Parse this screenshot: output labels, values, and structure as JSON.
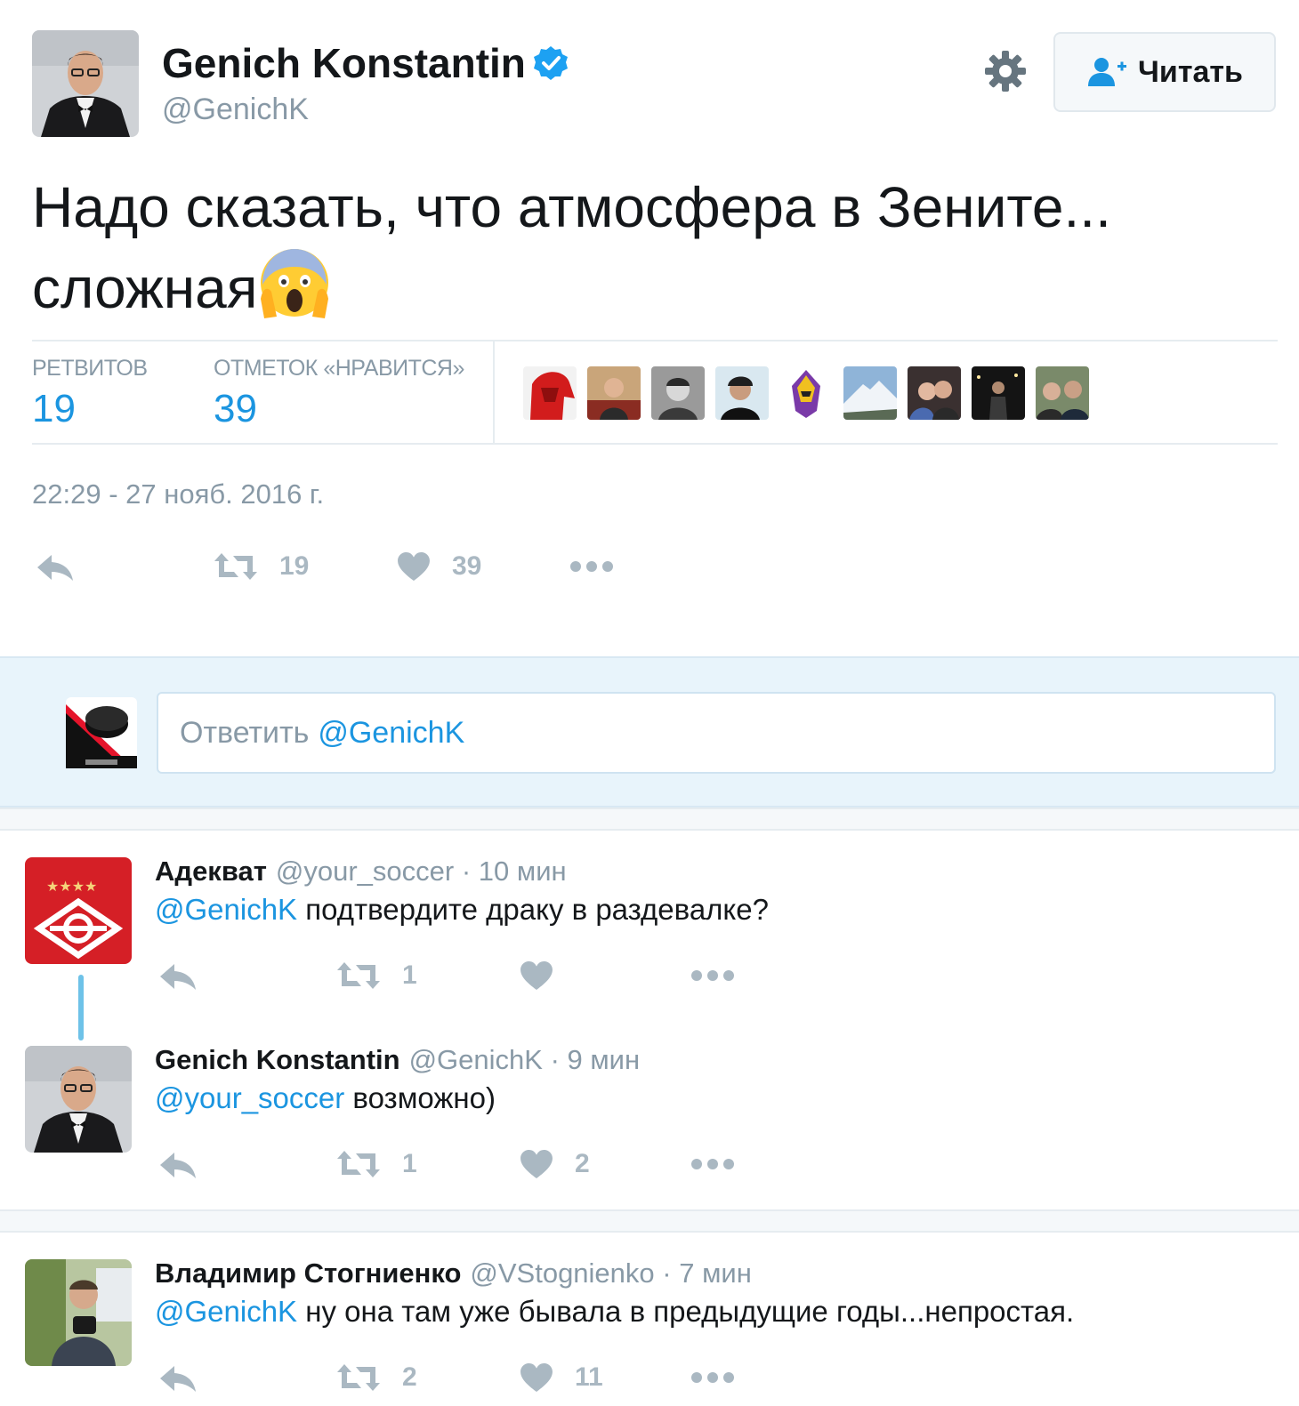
{
  "colors": {
    "accent": "#1b95e0",
    "muted": "#8899a6",
    "icon": "#aab8c2",
    "verified": "#1da1f2"
  },
  "tweet": {
    "author_name": "Genich Konstantin",
    "author_handle": "@GenichK",
    "follow_label": "Читать",
    "text_line1": "Надо сказать, что атмосфера в Зените...",
    "text_line2": "сложная",
    "emoji": "face-screaming-in-fear",
    "retweets_label": "РЕТВИТОВ",
    "retweets_value": "19",
    "likes_label": "ОТМЕТОК «НРАВИТСЯ»",
    "likes_value": "39",
    "timestamp": "22:29 - 27 нояб. 2016 г.",
    "action_retweet_count": "19",
    "action_like_count": "39"
  },
  "reply_box": {
    "placeholder": "Ответить",
    "mention": "@GenichK"
  },
  "replies": [
    {
      "name": "Адекват",
      "handle": "@your_soccer",
      "time": "· 10 мин",
      "mention": "@GenichK",
      "text": " подтвердите драку в раздевалке?",
      "retweets": "1",
      "likes": ""
    },
    {
      "name": "Genich Konstantin",
      "handle": "@GenichK",
      "time": "· 9 мин",
      "mention": "@your_soccer",
      "text": " возможно)",
      "retweets": "1",
      "likes": "2"
    },
    {
      "name": "Владимир Стогниенко",
      "handle": "@VStognienko",
      "time": "· 7 мин",
      "mention": "@GenichK",
      "text": " ну она там уже бывала в предыдущие годы...непростая.",
      "retweets": "2",
      "likes": "11"
    }
  ]
}
